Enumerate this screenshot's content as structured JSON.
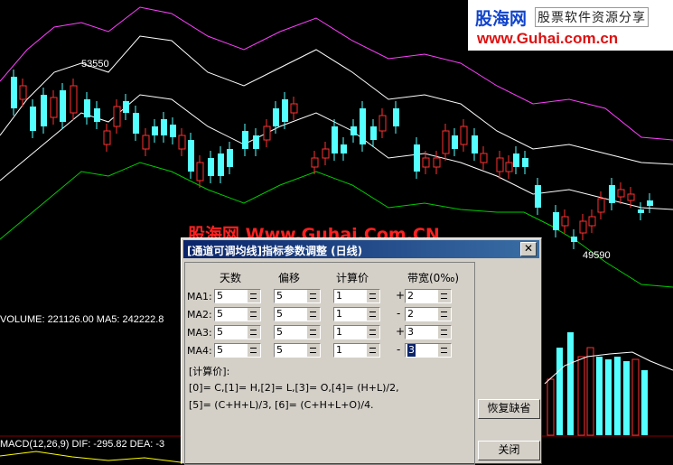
{
  "chart": {
    "price_high_label": "53550",
    "price_low_label": "49590",
    "volume_label": "VOLUME: 221126.00  MA5: 242222.8",
    "macd_label": "MACD(12,26,9)  DIF: -295.82  DEA: -3",
    "colors": {
      "up": "#ff3030",
      "down": "#54ffff",
      "upper_band": "#ff40ff",
      "mid_band": "#ffffff",
      "lower_band": "#00cc00",
      "background": "#000000"
    }
  },
  "watermark": "股海网 Www.Guhai.Com.CN",
  "logo": {
    "name": "股海网",
    "slogan": "股票软件资源分享",
    "url": "www.Guhai.com.cn"
  },
  "dialog": {
    "title": "[通道可调均线]指标参数调整 (日线)",
    "close_glyph": "✕",
    "headers": {
      "days": "天数",
      "offset": "偏移",
      "price": "计算价",
      "bandwidth": "带宽(0‰)"
    },
    "rows": [
      {
        "label": "MA1:",
        "days": "5",
        "offset": "5",
        "price": "1",
        "sign": "+",
        "band": "2"
      },
      {
        "label": "MA2:",
        "days": "5",
        "offset": "5",
        "price": "1",
        "sign": "-",
        "band": "2"
      },
      {
        "label": "MA3:",
        "days": "5",
        "offset": "5",
        "price": "1",
        "sign": "+",
        "band": "3"
      },
      {
        "label": "MA4:",
        "days": "5",
        "offset": "5",
        "price": "1",
        "sign": "-",
        "band": "3"
      }
    ],
    "formula_title": "[计算价]:",
    "formula_lines": [
      "[0]= C,[1]= H,[2]= L,[3]= O,[4]=  (H+L)/2,",
      "[5]=  (C+H+L)/3,  [6]=  (C+H+L+O)/4."
    ],
    "restore_button": "恢复缺省",
    "close_button": "关闭"
  }
}
